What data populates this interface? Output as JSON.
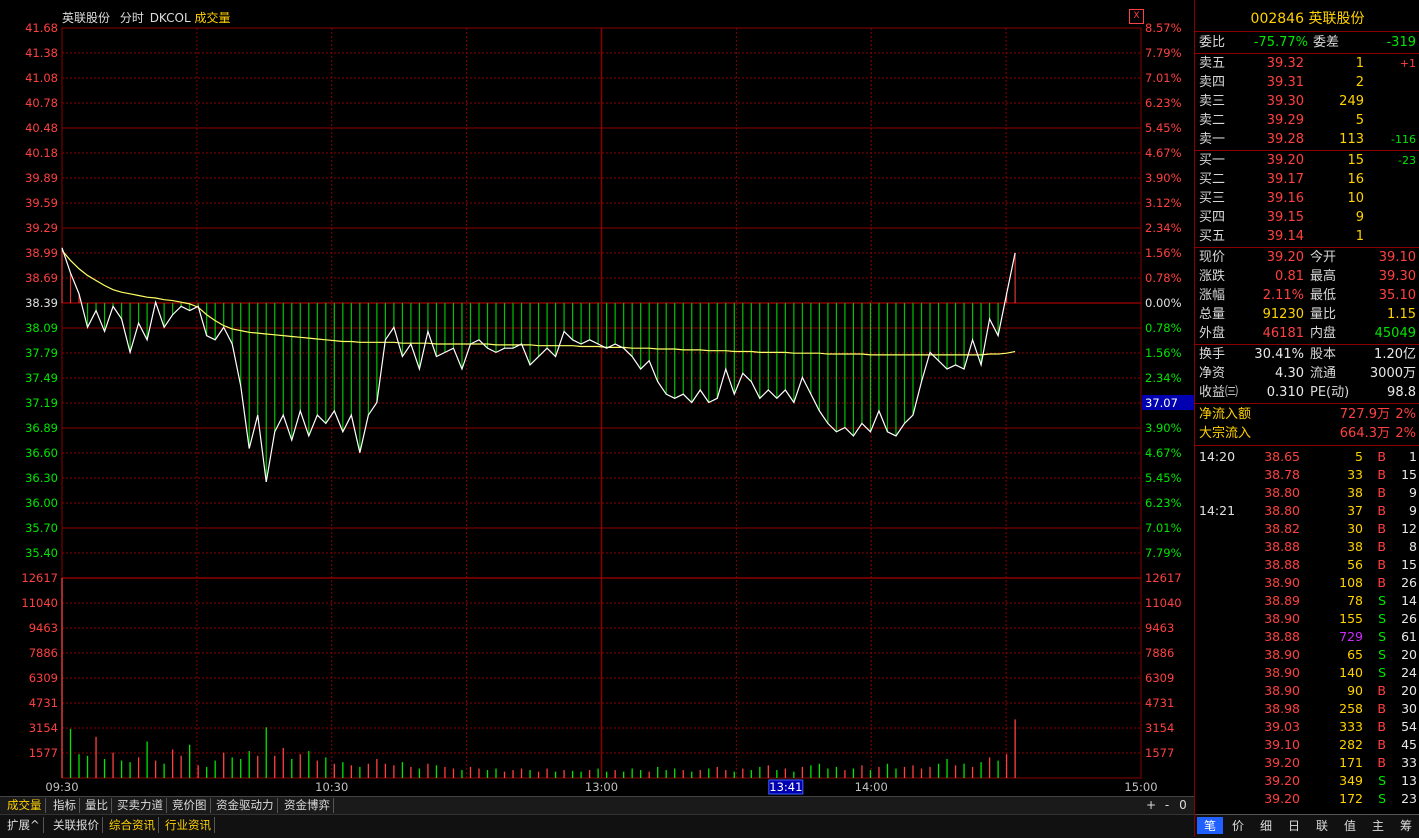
{
  "header": {
    "name": "英联股份",
    "mode": "分时",
    "indicator": "DKCOL",
    "sub": "成交量"
  },
  "close_btn": "X",
  "axes": {
    "price_left": [
      "41.68",
      "41.38",
      "41.08",
      "40.78",
      "40.48",
      "40.18",
      "39.89",
      "39.59",
      "39.29",
      "38.99",
      "38.69",
      "38.39",
      "38.09",
      "37.79",
      "37.49",
      "37.19",
      "36.89",
      "36.60",
      "36.30",
      "36.00",
      "35.70",
      "35.40"
    ],
    "pct_right": [
      "8.57%",
      "7.79%",
      "7.01%",
      "6.23%",
      "5.45%",
      "4.67%",
      "3.90%",
      "3.12%",
      "2.34%",
      "1.56%",
      "0.78%",
      "0.00%",
      "0.78%",
      "1.56%",
      "2.34%",
      "3.12%",
      "3.90%",
      "4.67%",
      "5.45%",
      "6.23%",
      "7.01%",
      "7.79%"
    ],
    "vol_left": [
      "12617",
      "11040",
      "9463",
      "7886",
      "6309",
      "4731",
      "3154",
      "1577"
    ],
    "vol_right": [
      "12617",
      "11040",
      "9463",
      "7886",
      "6309",
      "4731",
      "3154",
      "1577"
    ],
    "times": [
      "09:30",
      "10:30",
      "13:00",
      "14:00",
      "15:00"
    ],
    "cursor_time": "13:41",
    "cursor_price": "37.07"
  },
  "chart_data": {
    "type": "line",
    "ylim": [
      35.4,
      41.68
    ],
    "prev_close": 38.39,
    "x": [
      0,
      3,
      6,
      9,
      12,
      15,
      18,
      21,
      24,
      27,
      30,
      33,
      36,
      39,
      42,
      45,
      48,
      51,
      54,
      57,
      60,
      63,
      66,
      69,
      72,
      75,
      78,
      81,
      84,
      87,
      90,
      93,
      96,
      99,
      102,
      105,
      108,
      111,
      114,
      117,
      120,
      123,
      126,
      129,
      132,
      135,
      138,
      141,
      144,
      147,
      150,
      153,
      156,
      159,
      162,
      165,
      168,
      171,
      174,
      177,
      180,
      183,
      186,
      189,
      192,
      195,
      198,
      201,
      204,
      207,
      210,
      213,
      216,
      219,
      222,
      225,
      228,
      231,
      234,
      237,
      240,
      243,
      246,
      249,
      252,
      255,
      258,
      261,
      264,
      267,
      270,
      273,
      276,
      279,
      282,
      285,
      288,
      291,
      294,
      297,
      300,
      303,
      306,
      309,
      312,
      315,
      318,
      321,
      324,
      327,
      330,
      333,
      336
    ],
    "price": [
      39.05,
      38.75,
      38.5,
      38.1,
      38.3,
      38.05,
      38.35,
      38.2,
      37.8,
      38.15,
      37.95,
      38.4,
      38.1,
      38.25,
      38.35,
      38.3,
      38.35,
      38.0,
      37.95,
      38.1,
      37.9,
      37.4,
      36.65,
      37.05,
      36.25,
      36.85,
      37.05,
      36.75,
      37.1,
      36.8,
      37.05,
      36.95,
      37.1,
      36.85,
      37.05,
      36.6,
      37.05,
      37.2,
      37.95,
      38.1,
      37.75,
      37.9,
      37.6,
      38.05,
      37.75,
      37.8,
      37.85,
      37.6,
      37.9,
      37.95,
      37.85,
      37.8,
      37.85,
      37.85,
      37.9,
      37.65,
      37.75,
      37.85,
      37.75,
      38.05,
      37.95,
      37.9,
      37.95,
      37.9,
      37.85,
      37.9,
      37.85,
      37.75,
      37.6,
      37.7,
      37.45,
      37.3,
      37.25,
      37.3,
      37.2,
      37.35,
      37.2,
      37.25,
      37.6,
      37.3,
      37.55,
      37.45,
      37.25,
      37.35,
      37.25,
      37.35,
      37.2,
      37.5,
      37.3,
      37.1,
      36.95,
      36.85,
      36.9,
      36.8,
      36.95,
      36.85,
      37.1,
      36.85,
      36.8,
      36.95,
      37.05,
      37.45,
      37.8,
      37.7,
      37.6,
      37.65,
      37.6,
      37.95,
      37.65,
      38.2,
      38.0,
      38.5,
      38.99
    ],
    "avg": [
      39.02,
      38.9,
      38.8,
      38.72,
      38.66,
      38.6,
      38.55,
      38.52,
      38.5,
      38.48,
      38.46,
      38.45,
      38.43,
      38.42,
      38.4,
      38.38,
      38.34,
      38.25,
      38.18,
      38.12,
      38.08,
      38.06,
      38.04,
      38.03,
      38.02,
      38.01,
      38.0,
      37.99,
      37.98,
      37.97,
      37.96,
      37.95,
      37.94,
      37.93,
      37.93,
      37.92,
      37.92,
      37.92,
      37.92,
      37.92,
      37.91,
      37.91,
      37.91,
      37.91,
      37.9,
      37.9,
      37.9,
      37.9,
      37.9,
      37.9,
      37.9,
      37.89,
      37.89,
      37.89,
      37.89,
      37.89,
      37.88,
      37.88,
      37.88,
      37.88,
      37.88,
      37.87,
      37.87,
      37.87,
      37.86,
      37.86,
      37.86,
      37.85,
      37.85,
      37.85,
      37.84,
      37.84,
      37.84,
      37.83,
      37.83,
      37.83,
      37.82,
      37.82,
      37.82,
      37.81,
      37.81,
      37.81,
      37.8,
      37.8,
      37.8,
      37.8,
      37.79,
      37.79,
      37.79,
      37.79,
      37.78,
      37.78,
      37.78,
      37.78,
      37.78,
      37.77,
      37.77,
      37.77,
      37.77,
      37.77,
      37.77,
      37.77,
      37.77,
      37.77,
      37.77,
      37.77,
      37.77,
      37.77,
      37.77,
      37.78,
      37.78,
      37.79,
      37.81
    ],
    "volume_ylim": [
      0,
      12617
    ],
    "volume": [
      12617,
      3100,
      1500,
      1400,
      2600,
      1200,
      1600,
      1100,
      1000,
      1300,
      2300,
      1100,
      900,
      1800,
      1400,
      2100,
      800,
      700,
      1100,
      1600,
      1300,
      1200,
      1700,
      1400,
      3200,
      1400,
      1900,
      1200,
      1500,
      1700,
      1100,
      1300,
      900,
      1000,
      800,
      700,
      900,
      1200,
      900,
      800,
      1000,
      700,
      600,
      900,
      800,
      700,
      600,
      500,
      700,
      600,
      500,
      600,
      400,
      500,
      600,
      500,
      400,
      600,
      400,
      500,
      450,
      400,
      500,
      600,
      400,
      500,
      400,
      600,
      500,
      400,
      700,
      500,
      600,
      500,
      400,
      500,
      600,
      700,
      500,
      400,
      600,
      500,
      700,
      800,
      500,
      600,
      400,
      700,
      800,
      900,
      600,
      700,
      500,
      600,
      800,
      500,
      700,
      900,
      600,
      700,
      800,
      600,
      700,
      900,
      1200,
      800,
      900,
      700,
      1000,
      1300,
      1100,
      1500,
      3700
    ]
  },
  "side": {
    "code": "002846",
    "name": "英联股份",
    "weibi_label": "委比",
    "weibi": "-75.77%",
    "weicha_label": "委差",
    "weicha": "-319",
    "asks": [
      {
        "label": "卖五",
        "price": "39.32",
        "vol": "1",
        "chg": "+1"
      },
      {
        "label": "卖四",
        "price": "39.31",
        "vol": "2",
        "chg": ""
      },
      {
        "label": "卖三",
        "price": "39.30",
        "vol": "249",
        "chg": ""
      },
      {
        "label": "卖二",
        "price": "39.29",
        "vol": "5",
        "chg": ""
      },
      {
        "label": "卖一",
        "price": "39.28",
        "vol": "113",
        "chg": "-116"
      }
    ],
    "bids": [
      {
        "label": "买一",
        "price": "39.20",
        "vol": "15",
        "chg": "-23"
      },
      {
        "label": "买二",
        "price": "39.17",
        "vol": "16",
        "chg": ""
      },
      {
        "label": "买三",
        "price": "39.16",
        "vol": "10",
        "chg": ""
      },
      {
        "label": "买四",
        "price": "39.15",
        "vol": "9",
        "chg": ""
      },
      {
        "label": "买五",
        "price": "39.14",
        "vol": "1",
        "chg": ""
      }
    ],
    "quote": [
      [
        "现价",
        "39.20",
        "今开",
        "39.10"
      ],
      [
        "涨跌",
        "0.81",
        "最高",
        "39.30"
      ],
      [
        "涨幅",
        "2.11%",
        "最低",
        "35.10"
      ],
      [
        "总量",
        "91230",
        "量比",
        "1.15"
      ],
      [
        "外盘",
        "46181",
        "内盘",
        "45049"
      ]
    ],
    "fund": [
      [
        "换手",
        "30.41%",
        "股本",
        "1.20亿"
      ],
      [
        "净资",
        "4.30",
        "流通",
        "3000万"
      ],
      [
        "收益㈢",
        "0.310",
        "PE(动)",
        "98.8"
      ]
    ],
    "flow": [
      [
        "净流入额",
        "727.9万",
        "2%"
      ],
      [
        "大宗流入",
        "664.3万",
        "2%"
      ]
    ],
    "ticks": [
      {
        "t": "14:20",
        "p": "38.65",
        "v": "5",
        "d": "B",
        "n": "1"
      },
      {
        "t": "",
        "p": "38.78",
        "v": "33",
        "d": "B",
        "n": "15"
      },
      {
        "t": "",
        "p": "38.80",
        "v": "38",
        "d": "B",
        "n": "9"
      },
      {
        "t": "14:21",
        "p": "38.80",
        "v": "37",
        "d": "B",
        "n": "9"
      },
      {
        "t": "",
        "p": "38.82",
        "v": "30",
        "d": "B",
        "n": "12"
      },
      {
        "t": "",
        "p": "38.88",
        "v": "38",
        "d": "B",
        "n": "8"
      },
      {
        "t": "",
        "p": "38.88",
        "v": "56",
        "d": "B",
        "n": "15"
      },
      {
        "t": "",
        "p": "38.90",
        "v": "108",
        "d": "B",
        "n": "26"
      },
      {
        "t": "",
        "p": "38.89",
        "v": "78",
        "d": "S",
        "n": "14"
      },
      {
        "t": "",
        "p": "38.90",
        "v": "155",
        "d": "S",
        "n": "26"
      },
      {
        "t": "",
        "p": "38.88",
        "v": "729",
        "d": "S",
        "n": "61"
      },
      {
        "t": "",
        "p": "38.90",
        "v": "65",
        "d": "S",
        "n": "20"
      },
      {
        "t": "",
        "p": "38.90",
        "v": "140",
        "d": "S",
        "n": "24"
      },
      {
        "t": "",
        "p": "38.90",
        "v": "90",
        "d": "B",
        "n": "20"
      },
      {
        "t": "",
        "p": "38.98",
        "v": "258",
        "d": "B",
        "n": "30"
      },
      {
        "t": "",
        "p": "39.03",
        "v": "333",
        "d": "B",
        "n": "54"
      },
      {
        "t": "",
        "p": "39.10",
        "v": "282",
        "d": "B",
        "n": "45"
      },
      {
        "t": "",
        "p": "39.20",
        "v": "171",
        "d": "B",
        "n": "33"
      },
      {
        "t": "",
        "p": "39.20",
        "v": "349",
        "d": "S",
        "n": "13"
      },
      {
        "t": "",
        "p": "39.20",
        "v": "172",
        "d": "S",
        "n": "23"
      }
    ],
    "bottom_tabs": [
      "笔",
      "价",
      "细",
      "日",
      "联",
      "值",
      "主",
      "筹"
    ]
  },
  "tabs": [
    "成交量",
    "指标",
    "量比",
    "买卖力道",
    "竞价图",
    "资金驱动力",
    "资金博弈"
  ],
  "tabs2": [
    "扩展^",
    "关联报价",
    "综合资讯",
    "行业资讯"
  ],
  "zoom": [
    "+",
    "-",
    "0"
  ],
  "colors": {
    "up": "#ff4040",
    "down": "#00e600",
    "grid": "#8a0000",
    "price": "#ffffff",
    "avg": "#ffff66"
  }
}
